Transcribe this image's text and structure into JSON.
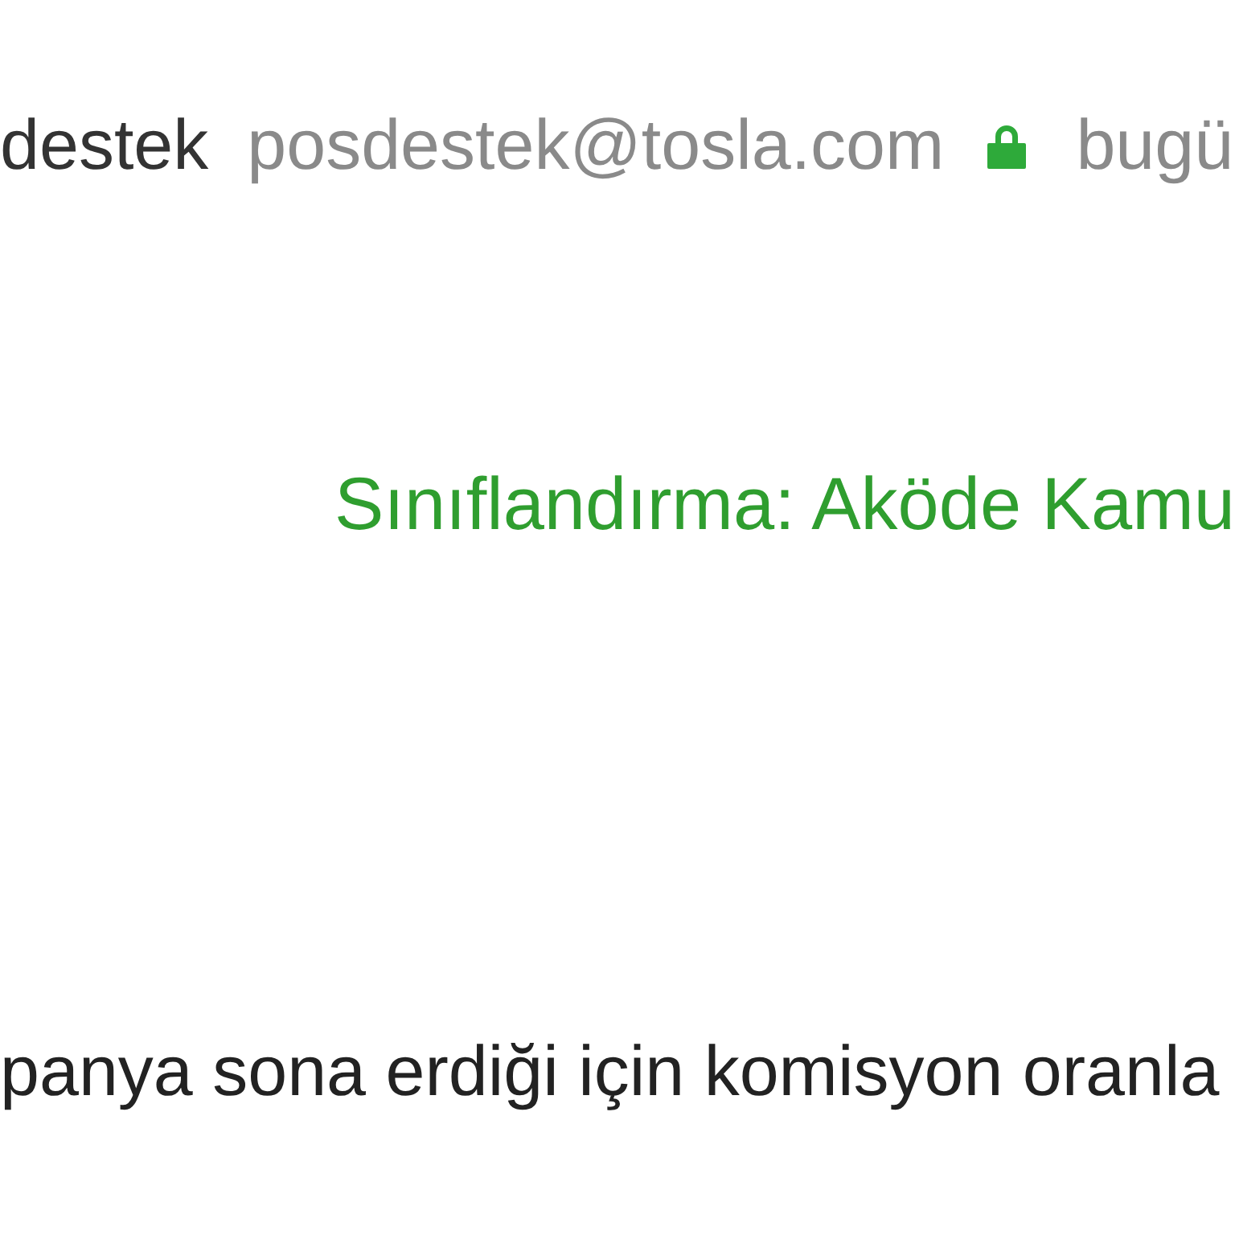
{
  "email_header": {
    "sender_name": "destek",
    "sender_address": "posdestek@tosla.com",
    "secure": true,
    "date": "bugü"
  },
  "classification": "Sınıflandırma: Aköde Kamu",
  "body": "panya sona erdiği için komisyon oranla"
}
